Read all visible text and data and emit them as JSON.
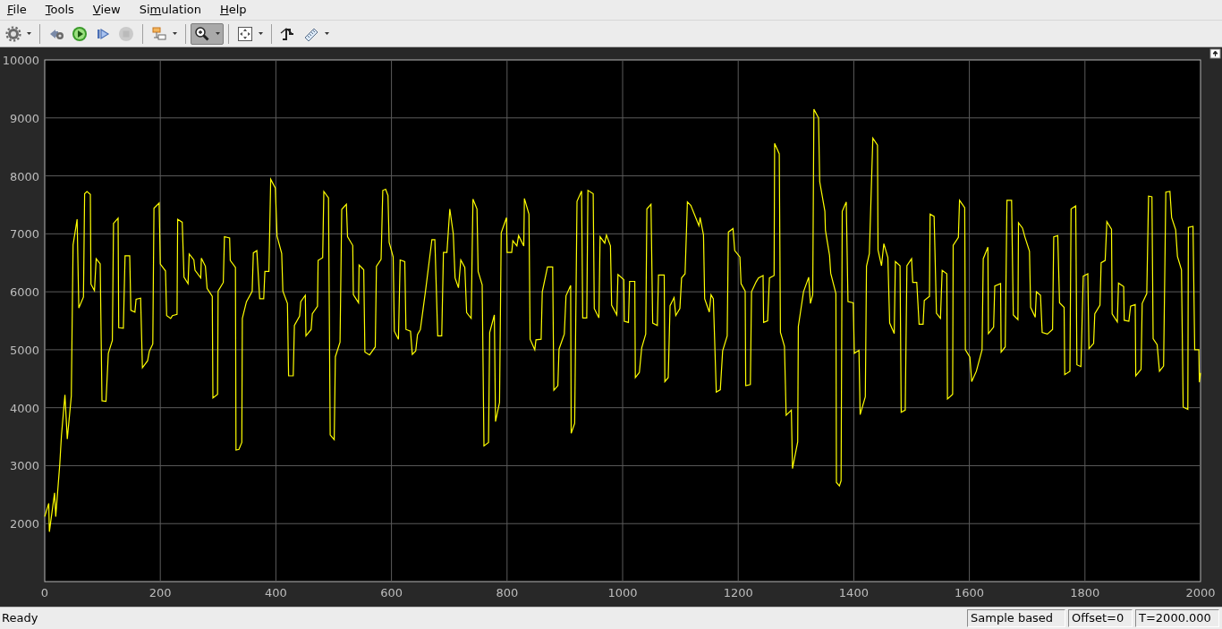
{
  "menu_bar": [
    {
      "mnemonic": "F",
      "after": "ile"
    },
    {
      "mnemonic": "T",
      "after": "ools"
    },
    {
      "mnemonic": "V",
      "after": "iew"
    },
    {
      "before": "Si",
      "mnemonic": "m",
      "after": "ulation"
    },
    {
      "mnemonic": "H",
      "after": "elp"
    }
  ],
  "toolbar": {
    "groups": [
      [
        {
          "pressed": false,
          "disabled": false,
          "dropdown": true
        }
      ],
      [
        {
          "pressed": false,
          "disabled": false,
          "dropdown": false
        },
        {
          "pressed": false,
          "disabled": false,
          "dropdown": false
        },
        {
          "pressed": false,
          "disabled": false,
          "dropdown": false
        },
        {
          "pressed": false,
          "disabled": true,
          "dropdown": false
        }
      ],
      [
        {
          "pressed": false,
          "disabled": false,
          "dropdown": true
        }
      ],
      [
        {
          "pressed": true,
          "disabled": false,
          "dropdown": true
        }
      ],
      [
        {
          "pressed": false,
          "disabled": false,
          "dropdown": true
        }
      ],
      [
        {
          "pressed": false,
          "disabled": false,
          "dropdown": false
        },
        {
          "pressed": false,
          "disabled": false,
          "dropdown": true
        }
      ]
    ]
  },
  "plot": {
    "chart_data": {
      "type": "line",
      "grid": true,
      "xlim": [
        0,
        2000
      ],
      "ylim": [
        1000,
        10000
      ],
      "xticks": [
        0,
        200,
        400,
        600,
        800,
        1000,
        1200,
        1400,
        1600,
        1800,
        2000
      ],
      "yticks": [
        2000,
        3000,
        4000,
        5000,
        6000,
        7000,
        8000,
        9000,
        10000
      ],
      "x": [
        0,
        7,
        8,
        17,
        19,
        26,
        29,
        35,
        39,
        46,
        49,
        56,
        59,
        67,
        69,
        73,
        79,
        80,
        86,
        89,
        96,
        99,
        106,
        110,
        117,
        119,
        127,
        128,
        136,
        139,
        147,
        149,
        156,
        158,
        166,
        169,
        178,
        181,
        187,
        189,
        198,
        200,
        209,
        211,
        218,
        221,
        229,
        230,
        238,
        241,
        248,
        250,
        258,
        260,
        270,
        271,
        278,
        281,
        290,
        291,
        299,
        300,
        309,
        311,
        320,
        321,
        330,
        331,
        336,
        341,
        342,
        349,
        359,
        361,
        367,
        372,
        379,
        381,
        388,
        391,
        399,
        402,
        410,
        412,
        420,
        422,
        430,
        432,
        441,
        443,
        451,
        452,
        461,
        463,
        472,
        473,
        481,
        483,
        491,
        494,
        501,
        503,
        511,
        514,
        522,
        524,
        533,
        534,
        543,
        544,
        552,
        554,
        562,
        572,
        574,
        582,
        585,
        590,
        594,
        596,
        603,
        605,
        612,
        615,
        623,
        625,
        633,
        636,
        642,
        645,
        650,
        659,
        670,
        675,
        680,
        687,
        690,
        696,
        701,
        707,
        710,
        716,
        720,
        727,
        730,
        738,
        741,
        748,
        750,
        757,
        760,
        768,
        770,
        778,
        780,
        787,
        790,
        799,
        800,
        808,
        810,
        817,
        820,
        829,
        830,
        838,
        840,
        848,
        850,
        859,
        861,
        870,
        879,
        881,
        888,
        890,
        899,
        902,
        910,
        911,
        917,
        921,
        929,
        931,
        938,
        940,
        949,
        951,
        959,
        961,
        969,
        972,
        979,
        981,
        990,
        992,
        1002,
        1003,
        1010,
        1012,
        1021,
        1022,
        1029,
        1033,
        1040,
        1042,
        1049,
        1052,
        1060,
        1062,
        1072,
        1073,
        1079,
        1082,
        1089,
        1092,
        1099,
        1102,
        1108,
        1112,
        1118,
        1132,
        1134,
        1140,
        1142,
        1150,
        1153,
        1157,
        1162,
        1169,
        1173,
        1181,
        1183,
        1191,
        1194,
        1203,
        1205,
        1212,
        1213,
        1221,
        1223,
        1231,
        1235,
        1243,
        1244,
        1251,
        1254,
        1262,
        1263,
        1271,
        1273,
        1280,
        1283,
        1292,
        1294,
        1303,
        1304,
        1313,
        1322,
        1325,
        1329,
        1331,
        1339,
        1341,
        1350,
        1351,
        1358,
        1360,
        1369,
        1370,
        1375,
        1378,
        1380,
        1387,
        1390,
        1399,
        1401,
        1409,
        1411,
        1420,
        1422,
        1427,
        1433,
        1441,
        1442,
        1448,
        1452,
        1459,
        1462,
        1470,
        1472,
        1480,
        1482,
        1489,
        1492,
        1500,
        1502,
        1509,
        1513,
        1520,
        1522,
        1531,
        1532,
        1539,
        1543,
        1550,
        1553,
        1561,
        1562,
        1571,
        1572,
        1581,
        1583,
        1592,
        1593,
        1601,
        1604,
        1612,
        1622,
        1624,
        1632,
        1633,
        1642,
        1644,
        1654,
        1655,
        1662,
        1665,
        1673,
        1676,
        1684,
        1685,
        1692,
        1696,
        1704,
        1706,
        1714,
        1716,
        1723,
        1726,
        1735,
        1744,
        1746,
        1753,
        1756,
        1764,
        1765,
        1774,
        1776,
        1784,
        1786,
        1793,
        1797,
        1805,
        1807,
        1815,
        1817,
        1826,
        1828,
        1835,
        1838,
        1846,
        1847,
        1856,
        1858,
        1867,
        1868,
        1876,
        1879,
        1887,
        1888,
        1897,
        1899,
        1907,
        1910,
        1916,
        1918,
        1925,
        1929,
        1936,
        1940,
        1947,
        1950,
        1957,
        1960,
        1967,
        1970,
        1978,
        1979,
        1987,
        1990,
        1997,
        1998,
        2000
      ],
      "series": [
        {
          "color": "#ffff00",
          "values": [
            2120,
            2350,
            1860,
            2530,
            2120,
            3020,
            3520,
            4220,
            3460,
            4200,
            6810,
            7250,
            5720,
            5910,
            7690,
            7730,
            7680,
            6130,
            6020,
            6570,
            6480,
            4120,
            4110,
            4940,
            5160,
            7180,
            7270,
            5380,
            5370,
            6620,
            6620,
            5680,
            5650,
            5870,
            5890,
            4690,
            4810,
            4970,
            5100,
            7440,
            7530,
            6480,
            6360,
            5590,
            5540,
            5590,
            5610,
            7250,
            7200,
            6250,
            6140,
            6650,
            6550,
            6370,
            6240,
            6580,
            6440,
            6060,
            5920,
            4170,
            4230,
            6010,
            6160,
            6950,
            6930,
            6540,
            6420,
            3270,
            3280,
            3400,
            5540,
            5830,
            6010,
            6670,
            6710,
            5880,
            5880,
            6350,
            6350,
            7940,
            7790,
            6960,
            6660,
            6010,
            5800,
            4550,
            4550,
            5420,
            5580,
            5830,
            5940,
            5240,
            5350,
            5620,
            5750,
            6540,
            6590,
            7730,
            7620,
            3530,
            3450,
            4880,
            5130,
            7420,
            7510,
            6950,
            6800,
            5950,
            5810,
            6460,
            6380,
            4960,
            4910,
            5050,
            6440,
            6560,
            7750,
            7770,
            7660,
            6850,
            6600,
            5320,
            5180,
            6550,
            6520,
            5350,
            5320,
            4920,
            4980,
            5260,
            5350,
            6020,
            6900,
            6900,
            5240,
            5240,
            6680,
            6680,
            7430,
            7000,
            6240,
            6070,
            6550,
            6420,
            5640,
            5540,
            7600,
            7430,
            6350,
            6120,
            3340,
            3400,
            5300,
            5600,
            3760,
            4090,
            7020,
            7280,
            6680,
            6680,
            6880,
            6790,
            6970,
            6790,
            7610,
            7340,
            5180,
            5000,
            5170,
            5180,
            6000,
            6430,
            6430,
            4300,
            4380,
            5010,
            5270,
            5930,
            6110,
            3560,
            3730,
            7560,
            7740,
            5550,
            5550,
            7750,
            7690,
            5710,
            5550,
            6950,
            6840,
            6980,
            6790,
            5770,
            5600,
            6300,
            6210,
            5490,
            5470,
            6180,
            6180,
            4520,
            4610,
            5030,
            5270,
            7430,
            7510,
            5460,
            5420,
            6290,
            6290,
            4450,
            4520,
            5760,
            5900,
            5590,
            5710,
            6240,
            6310,
            7550,
            7490,
            7140,
            7280,
            6980,
            5880,
            5650,
            5950,
            5880,
            4270,
            4310,
            4980,
            5240,
            7030,
            7090,
            6710,
            6600,
            6140,
            6010,
            4380,
            4400,
            6000,
            6170,
            6240,
            6280,
            5470,
            5500,
            6240,
            6280,
            8560,
            8380,
            5300,
            5060,
            3870,
            3960,
            2950,
            3410,
            5400,
            6000,
            6250,
            5800,
            5950,
            9150,
            9000,
            7900,
            7390,
            7060,
            6630,
            6320,
            5970,
            2710,
            2650,
            2740,
            7390,
            7550,
            5830,
            5810,
            4940,
            4990,
            3880,
            4190,
            6440,
            6660,
            8650,
            8530,
            6720,
            6450,
            6830,
            6590,
            5460,
            5280,
            6520,
            6450,
            3920,
            3960,
            6450,
            6570,
            6160,
            6160,
            5440,
            5440,
            5850,
            5920,
            7340,
            7300,
            5630,
            5540,
            6370,
            6310,
            4150,
            4230,
            6800,
            6940,
            7580,
            7450,
            5000,
            4870,
            4450,
            4630,
            5000,
            6570,
            6770,
            5280,
            5390,
            6100,
            6140,
            4960,
            5050,
            7580,
            7580,
            5600,
            5520,
            7190,
            7100,
            6950,
            6700,
            5730,
            5560,
            6000,
            5940,
            5300,
            5270,
            5350,
            6950,
            6970,
            5810,
            5730,
            4570,
            4630,
            7430,
            7480,
            4740,
            4710,
            6270,
            6310,
            5020,
            5110,
            5620,
            5770,
            6500,
            6540,
            7210,
            7080,
            5620,
            5480,
            6150,
            6090,
            5510,
            5490,
            5750,
            5780,
            4550,
            4660,
            5800,
            5970,
            7650,
            7640,
            5190,
            5090,
            4630,
            4720,
            7720,
            7730,
            7280,
            7070,
            6610,
            6380,
            4010,
            3970,
            7110,
            7130,
            5000,
            5000,
            4440,
            4600
          ]
        }
      ]
    }
  },
  "status_bar": {
    "message": "Ready",
    "fields": [
      "Sample based",
      "Offset=0",
      "T=2000.000"
    ]
  }
}
